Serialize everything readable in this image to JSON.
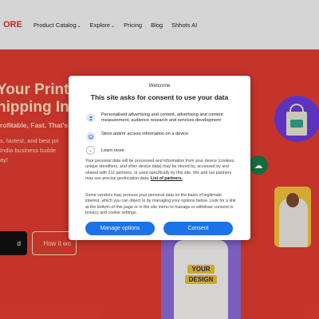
{
  "nav": {
    "logo": "ORE",
    "items": [
      {
        "label": "Product Catalog",
        "chevron": "⌄"
      },
      {
        "label": "Explore",
        "chevron": "⌄"
      },
      {
        "label": "Pricing"
      },
      {
        "label": "Blog"
      },
      {
        "label": "Shhots AI"
      }
    ]
  },
  "hero": {
    "title_line1": "Your Print on",
    "title_line2": "hipping In Ind",
    "subtitle": "rofitable, Fast. That's y",
    "desc_line1": "s, fastest, and best pri",
    "desc_line2": "India business builde",
    "desc_line3": "ay!",
    "primary_button": "d",
    "secondary_button": "How it wo",
    "tshirt_text1": "YOUR",
    "tshirt_text2": "DESIGN"
  },
  "consent": {
    "brand": "Welcome",
    "title": "This site asks for consent to use your data",
    "purposes": [
      {
        "icon": "person-icon",
        "text": "Personalised advertising and content, advertising and content measurement, audience research and services development"
      },
      {
        "icon": "device-icon",
        "text": "Store and/or access information on a device"
      }
    ],
    "learn_more": "Learn more",
    "paragraph1": "Your personal data will be processed and information from your device (cookies, unique identifiers, and other device data) may be stored by, accessed by and shared with 211 partners, or used specifically by this site. We and our partners may use precise geolocation data.",
    "partners_link": "List of partners.",
    "paragraph2": "Some vendors may process your personal data on the basis of legitimate interest, which you can object to by managing your options below. Look for a link at the bottom of this page or in the site menu to manage or withdraw consent in privacy and cookie settings.",
    "manage_button": "Manage options",
    "consent_button": "Consent"
  },
  "colors": {
    "hero_bg": "#e03c31",
    "accent_blue": "#1a73e8"
  }
}
